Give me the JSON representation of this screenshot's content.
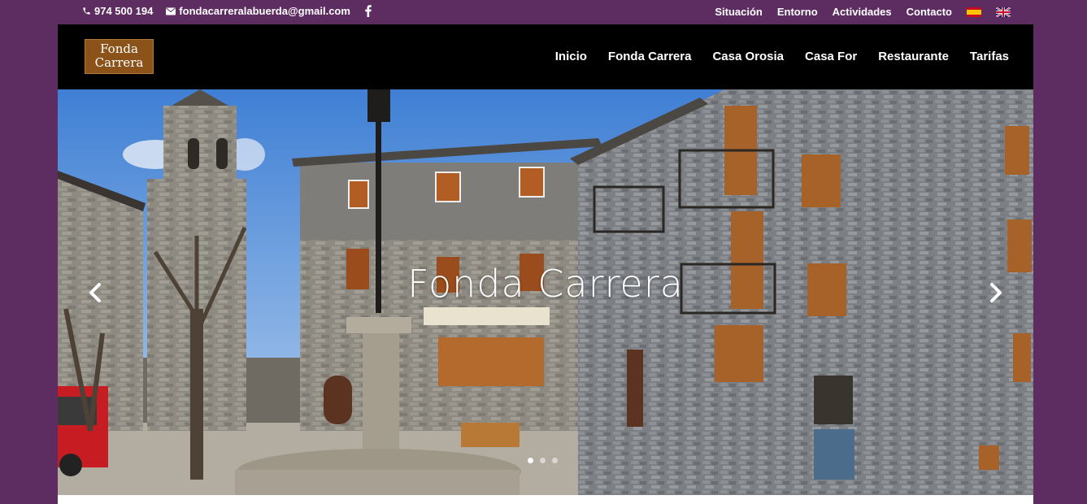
{
  "topbar": {
    "phone": "974 500 194",
    "email": "fondacarreralabuerda@gmail.com",
    "links": [
      "Situación",
      "Entorno",
      "Actividades",
      "Contacto"
    ],
    "icons": {
      "phone": "phone-icon",
      "email": "envelope-icon",
      "facebook": "facebook-icon"
    },
    "languages": [
      {
        "name": "spanish-flag"
      },
      {
        "name": "english-flag"
      }
    ]
  },
  "header": {
    "logo": {
      "line1": "Fonda",
      "line2": "Carrera"
    },
    "nav": [
      "Inicio",
      "Fonda Carrera",
      "Casa Orosia",
      "Casa For",
      "Restaurante",
      "Tarifas"
    ]
  },
  "hero": {
    "title": "Fonda Carrera",
    "slides_total": 3,
    "active_slide": 1,
    "prev_icon": "chevron-left-icon",
    "next_icon": "chevron-right-icon"
  },
  "colors": {
    "background": "#5d2d62",
    "header": "#000000",
    "logo": "#8b5319"
  }
}
